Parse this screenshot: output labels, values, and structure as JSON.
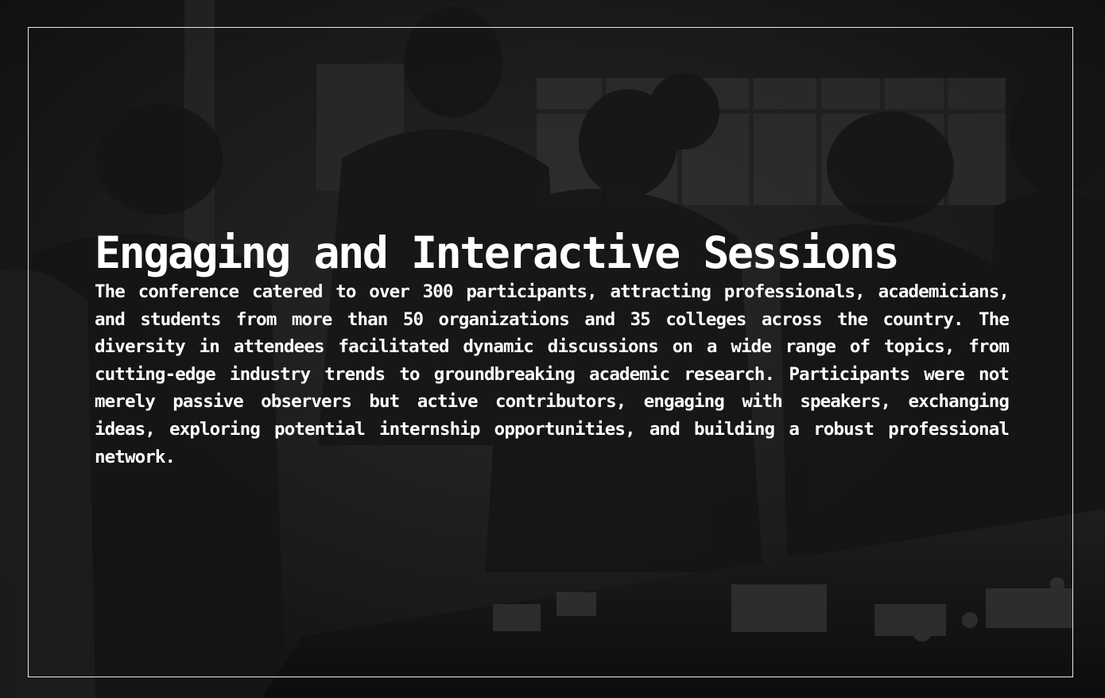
{
  "slide": {
    "title": "Engaging and Interactive Sessions",
    "body": "The conference catered to over 300 participants, attracting professionals, academicians, and students from more than 50 organizations and 35 colleges across the country. The diversity in attendees facilitated dynamic discussions on a wide range of topics, from cutting-edge industry trends to groundbreaking academic research. Participants were not merely passive observers but active contributors, engaging with speakers, exchanging ideas, exploring potential internship opportunities, and building a robust professional network."
  },
  "colors": {
    "text": "#ffffff",
    "frame": "#e8e8e8",
    "background": "#232323"
  }
}
